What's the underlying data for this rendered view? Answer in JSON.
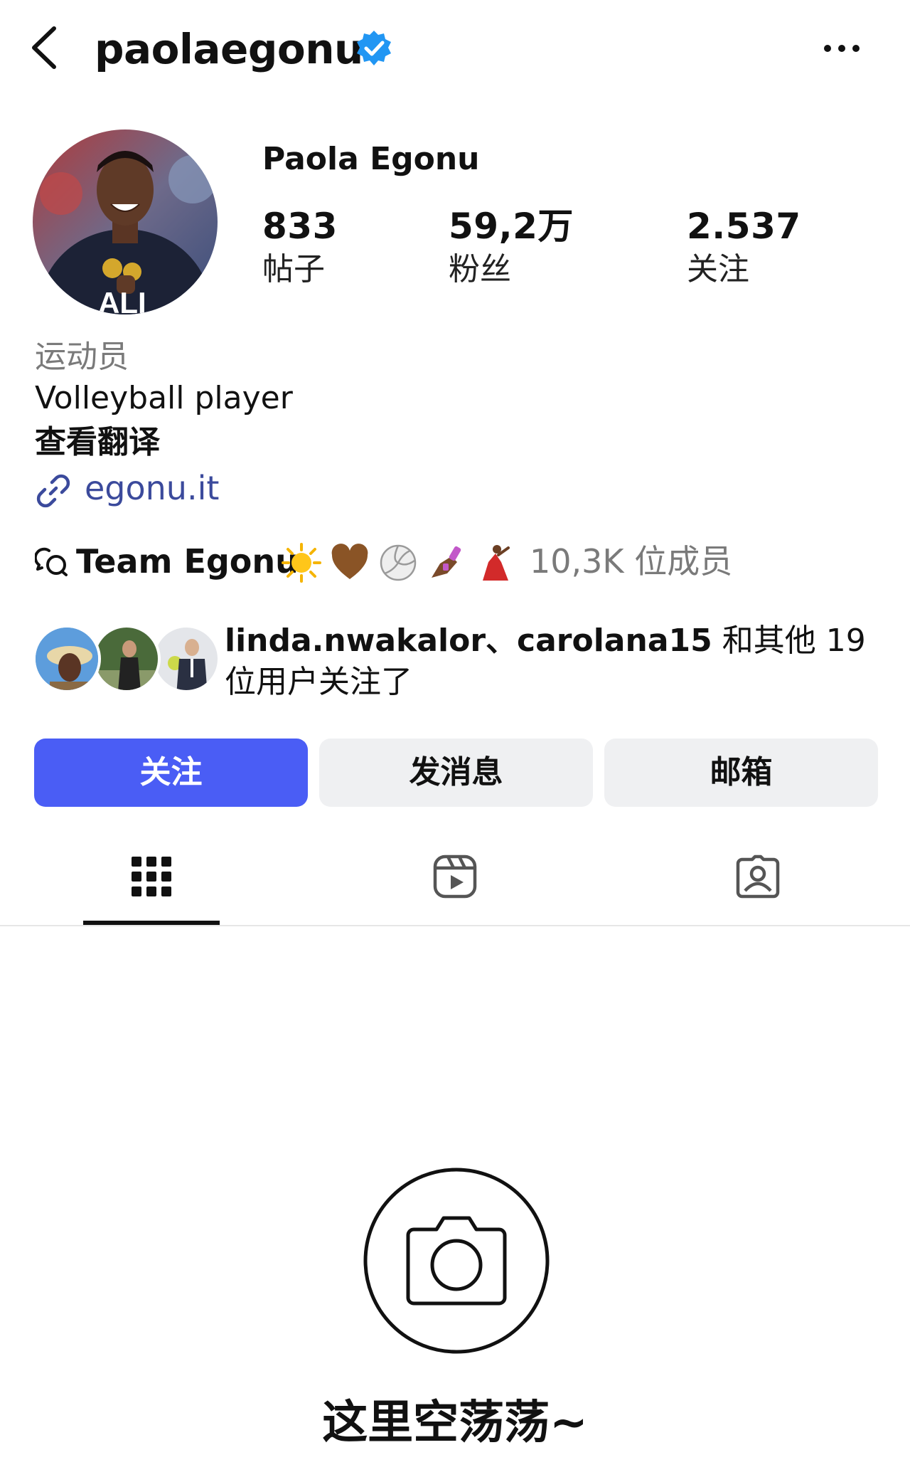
{
  "header": {
    "username": "paolaegonu",
    "verified_icon": "verified-badge-icon",
    "back_icon": "chevron-left-icon",
    "more_icon": "more-dots-icon"
  },
  "profile": {
    "display_name": "Paola Egonu",
    "stats": [
      {
        "value": "833",
        "label": "帖子"
      },
      {
        "value": "59,2万",
        "label": "粉丝"
      },
      {
        "value": "2.537",
        "label": "关注"
      }
    ],
    "category": "运动员",
    "bio": "Volleyball player",
    "translate_label": "查看翻译",
    "link": "egonu.it"
  },
  "channel": {
    "name": "Team Egonu",
    "emojis": [
      "sun",
      "brown-heart",
      "volleyball",
      "nail-polish",
      "dancer"
    ],
    "members": "10,3K 位成员"
  },
  "mutual": {
    "names": "linda.nwakalor、carolana15",
    "suffix": " 和其他 19 位用户关注了"
  },
  "buttons": {
    "follow": "关注",
    "message": "发消息",
    "email": "邮箱"
  },
  "tabs": [
    {
      "icon": "grid-icon",
      "active": true
    },
    {
      "icon": "reels-icon",
      "active": false
    },
    {
      "icon": "tagged-icon",
      "active": false
    }
  ],
  "empty_state": {
    "text": "这里空荡荡~"
  },
  "colors": {
    "accent": "#4a5df5",
    "verified": "#2196f3",
    "link": "#3b4a9c",
    "secondary_text": "#7a7a7a",
    "button_bg": "#eff0f2"
  }
}
